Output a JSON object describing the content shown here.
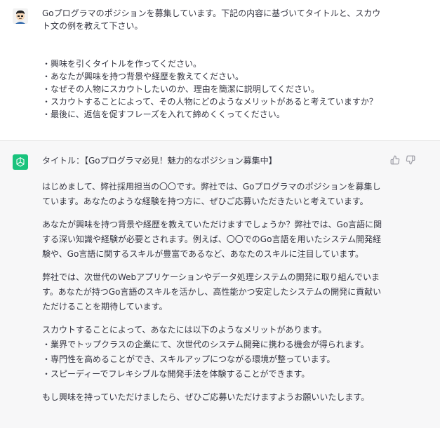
{
  "user_message": {
    "text": "Goプログラマのポジションを募集しています。下記の内容に基づいてタイトルと、スカウト文の例を教えて下さい。\n\n\n・興味を引くタイトルを作ってください。\n・あなたが興味を持つ背景や経歴を教えてください。\n・なぜその人物にスカウトしたいのか、理由を簡潔に説明してください。\n・スカウトすることによって、その人物にどのようなメリットがあると考えていますか？\n・最後に、返信を促すフレーズを入れて締めくくってください。"
  },
  "assistant_message": {
    "title_line": "タイトル：【Goプログラマ必見！魅力的なポジション募集中】",
    "paragraphs": [
      "はじめまして、弊社採用担当の〇〇です。弊社では、Goプログラマのポジションを募集しています。あなたのような経験を持つ方に、ぜひご応募いただきたいと考えています。",
      "あなたが興味を持つ背景や経歴を教えていただけますでしょうか？弊社では、Go言語に関する深い知識や経験が必要とされます。例えば、〇〇でのGo言語を用いたシステム開発経験や、Go言語に関するスキルが豊富であるなど、あなたのスキルに注目しています。",
      "弊社では、次世代のWebアプリケーションやデータ処理システムの開発に取り組んでいます。あなたが持つGo言語のスキルを活かし、高性能かつ安定したシステムの開発に貢献いただけることを期待しています。",
      "スカウトすることによって、あなたには以下のようなメリットがあります。\n・業界でトップクラスの企業にて、次世代のシステム開発に携わる機会が得られます。\n・専門性を高めることができ、スキルアップにつながる環境が整っています。\n・スピーディーでフレキシブルな開発手法を体験することができます。",
      "もし興味を持っていただけましたら、ぜひご応募いただけますようお願いいたします。"
    ]
  },
  "icons": {
    "user_avatar": "user-avatar-icon",
    "assistant_avatar": "chatgpt-logo-icon",
    "thumbs_up": "thumbs-up-icon",
    "thumbs_down": "thumbs-down-icon"
  },
  "colors": {
    "assistant_bg": "#f7f7f8",
    "gpt_green": "#19c37d",
    "text": "#343541"
  }
}
